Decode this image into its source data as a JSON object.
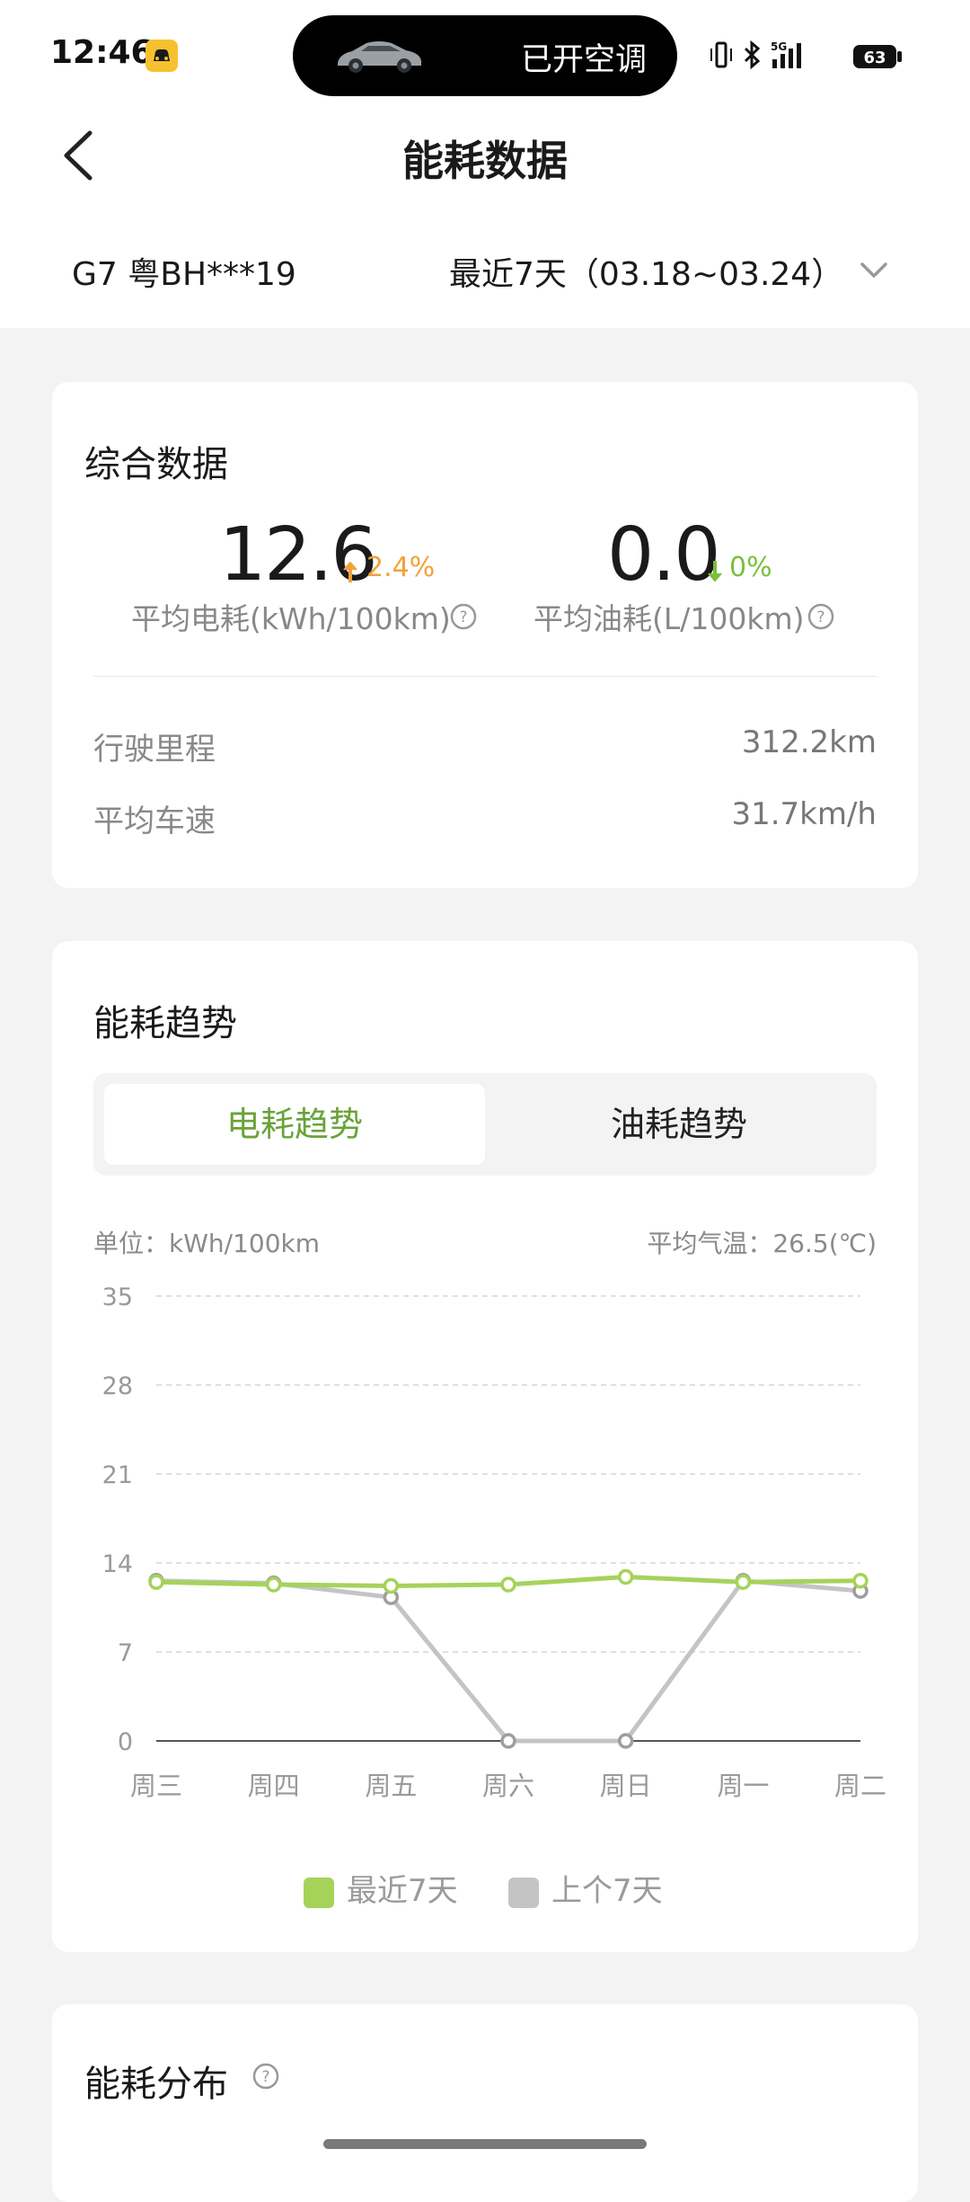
{
  "status_bar": {
    "time": "12:46",
    "island_text": "已开空调",
    "battery": "63"
  },
  "header": {
    "title": "能耗数据",
    "vehicle": "G7 粤BH***19",
    "range": "最近7天（03.18~03.24）"
  },
  "overview": {
    "title": "综合数据",
    "electric": {
      "value": "12.6",
      "change": "2.4%",
      "direction": "up",
      "label": "平均电耗(kWh/100km)"
    },
    "fuel": {
      "value": "0.0",
      "change": "0%",
      "direction": "down",
      "label": "平均油耗(L/100km)"
    },
    "rows": [
      {
        "label": "行驶里程",
        "value": "312.2km"
      },
      {
        "label": "平均车速",
        "value": "31.7km/h"
      }
    ]
  },
  "trend": {
    "title": "能耗趋势",
    "tabs": [
      "电耗趋势",
      "油耗趋势"
    ],
    "active_tab": "电耗趋势",
    "unit_label": "单位：kWh/100km",
    "temp_label": "平均气温：26.5(℃)",
    "legend": [
      {
        "name": "最近7天",
        "color": "#a5d35a"
      },
      {
        "name": "上个7天",
        "color": "#c4c4c4"
      }
    ]
  },
  "distribution": {
    "title": "能耗分布"
  },
  "colors": {
    "accent_green": "#a5d35a",
    "tab_green": "#6aa33a",
    "up_orange": "#f2a23b",
    "down_green": "#7cbf3c"
  },
  "chart_data": {
    "type": "line",
    "categories": [
      "周三",
      "周四",
      "周五",
      "周六",
      "周日",
      "周一",
      "周二"
    ],
    "series": [
      {
        "name": "最近7天",
        "values": [
          12.5,
          12.3,
          12.2,
          12.3,
          12.9,
          12.5,
          12.6
        ]
      },
      {
        "name": "上个7天",
        "values": [
          12.6,
          12.4,
          11.3,
          0,
          0,
          12.6,
          11.8
        ]
      }
    ],
    "yticks": [
      0,
      7,
      14,
      21,
      28,
      35
    ],
    "ylim": [
      0,
      35
    ],
    "grid": true,
    "legend_position": "bottom"
  }
}
